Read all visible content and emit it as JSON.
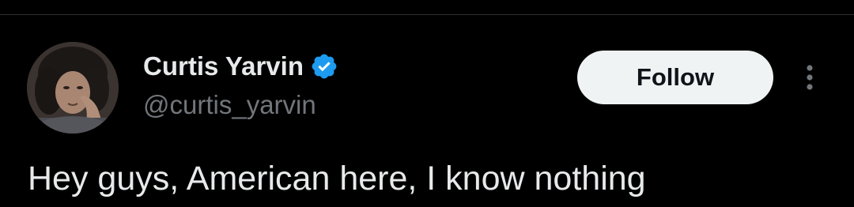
{
  "colors": {
    "background": "#000000",
    "primary_text": "#e7e9ea",
    "secondary_text": "#71767b",
    "verified_badge": "#1d9bf0",
    "follow_button_bg": "#eff3f4",
    "follow_button_text": "#0f1419",
    "divider": "#2f3336"
  },
  "author": {
    "display_name": "Curtis Yarvin",
    "handle": "@curtis_yarvin",
    "verified": true,
    "avatar_icon": "profile-photo"
  },
  "actions": {
    "follow_label": "Follow",
    "more_icon": "more-vertical-icon"
  },
  "tweet": {
    "text": "Hey guys, American here, I know nothing"
  }
}
